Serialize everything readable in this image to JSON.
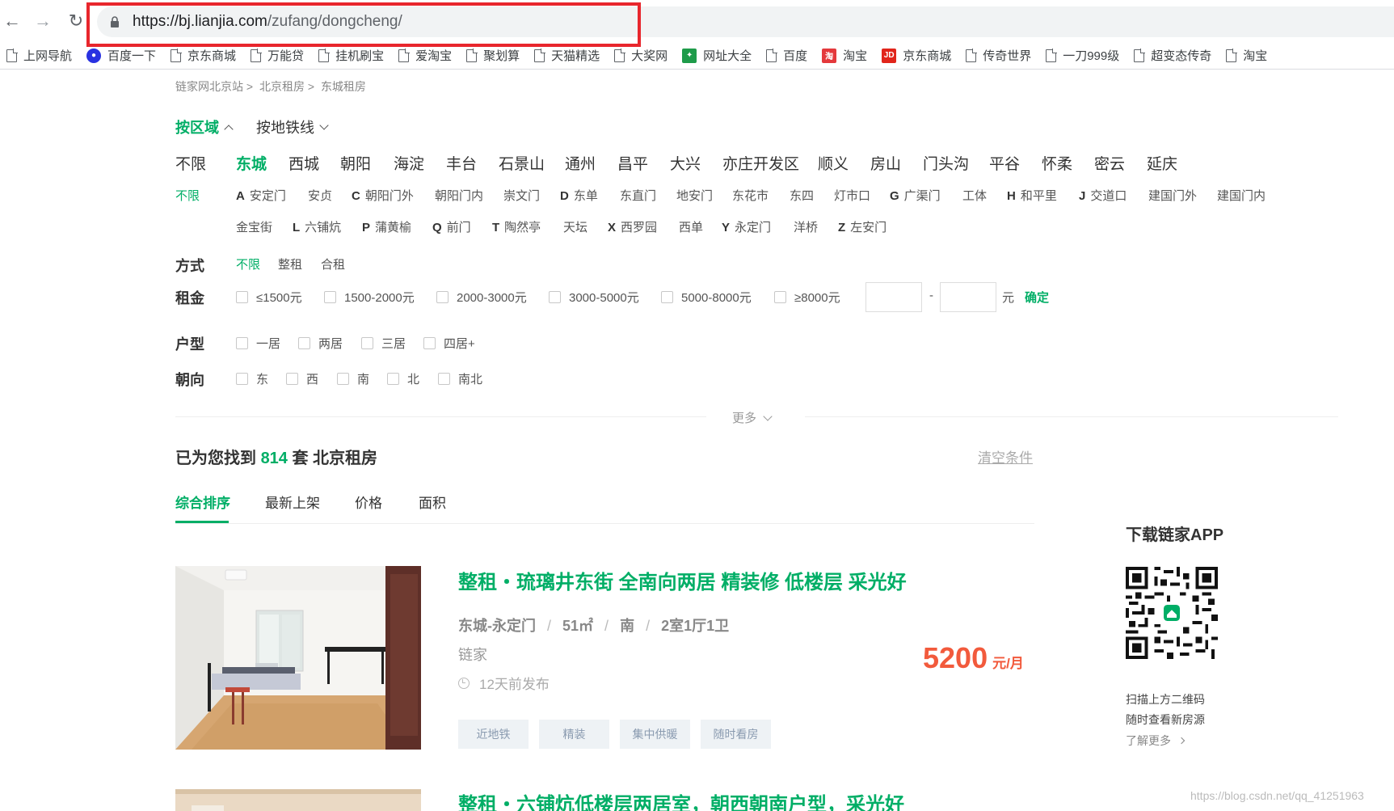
{
  "browser": {
    "url_host": "https://bj.lianjia.com",
    "url_path": "/zufang/dongcheng/",
    "bookmarks": [
      "上网导航",
      "百度一下",
      "京东商城",
      "万能贷",
      "挂机刷宝",
      "爱淘宝",
      "聚划算",
      "天猫精选",
      "大奖网",
      "网址大全",
      "百度",
      "淘宝",
      "京东商城",
      "传奇世界",
      "一刀999级",
      "超变态传奇",
      "淘宝"
    ],
    "fav_labels": {
      "taobao": "淘",
      "jd": "JD"
    }
  },
  "breadcrumb": [
    "链家网北京站 >",
    "北京租房 >",
    "东城租房"
  ],
  "region_tabs": [
    "按区域",
    "按地铁线"
  ],
  "districts": [
    "不限",
    "东城",
    "西城",
    "朝阳",
    "海淀",
    "丰台",
    "石景山",
    "通州",
    "昌平",
    "大兴",
    "亦庄开发区",
    "顺义",
    "房山",
    "门头沟",
    "平谷",
    "怀柔",
    "密云",
    "延庆"
  ],
  "subdistricts": {
    "all": "不限",
    "row1": [
      {
        "letter": "A",
        "name": "安定门"
      },
      {
        "letter": "",
        "name": "安贞"
      },
      {
        "letter": "C",
        "name": "朝阳门外"
      },
      {
        "letter": "",
        "name": "朝阳门内"
      },
      {
        "letter": "",
        "name": "崇文门"
      },
      {
        "letter": "D",
        "name": "东单"
      },
      {
        "letter": "",
        "name": "东直门"
      },
      {
        "letter": "",
        "name": "地安门"
      },
      {
        "letter": "",
        "name": "东花市"
      },
      {
        "letter": "",
        "name": "东四"
      },
      {
        "letter": "",
        "name": "灯市口"
      },
      {
        "letter": "G",
        "name": "广渠门"
      },
      {
        "letter": "",
        "name": "工体"
      },
      {
        "letter": "H",
        "name": "和平里"
      },
      {
        "letter": "J",
        "name": "交道口"
      },
      {
        "letter": "",
        "name": "建国门外"
      },
      {
        "letter": "",
        "name": "建国门内"
      }
    ],
    "row2": [
      {
        "letter": "",
        "name": "金宝街"
      },
      {
        "letter": "L",
        "name": "六铺炕"
      },
      {
        "letter": "P",
        "name": "蒲黄榆"
      },
      {
        "letter": "Q",
        "name": "前门"
      },
      {
        "letter": "T",
        "name": "陶然亭"
      },
      {
        "letter": "",
        "name": "天坛"
      },
      {
        "letter": "X",
        "name": "西罗园"
      },
      {
        "letter": "",
        "name": "西单"
      },
      {
        "letter": "Y",
        "name": "永定门"
      },
      {
        "letter": "",
        "name": "洋桥"
      },
      {
        "letter": "Z",
        "name": "左安门"
      }
    ]
  },
  "filters": {
    "mode_label": "方式",
    "modes": [
      "不限",
      "整租",
      "合租"
    ],
    "rent_label": "租金",
    "rent_options": [
      "≤1500元",
      "1500-2000元",
      "2000-3000元",
      "3000-5000元",
      "5000-8000元",
      "≥8000元"
    ],
    "rent_dash": "-",
    "rent_unit": "元",
    "rent_confirm": "确定",
    "layout_label": "户型",
    "layout_options": [
      "一居",
      "两居",
      "三居",
      "四居+"
    ],
    "orient_label": "朝向",
    "orient_options": [
      "东",
      "西",
      "南",
      "北",
      "南北"
    ],
    "more": "更多"
  },
  "result": {
    "prefix": "已为您找到",
    "count": "814",
    "suffix": "套 北京租房",
    "clear": "清空条件"
  },
  "sort_tabs": [
    "综合排序",
    "最新上架",
    "价格",
    "面积"
  ],
  "listings": [
    {
      "title": "整租・琉璃井东街 全南向两居 精装修 低楼层 采光好",
      "location": "东城-永定门",
      "area": "51㎡",
      "orientation": "南",
      "rooms": "2室1厅1卫",
      "brand": "链家",
      "time": "12天前发布",
      "tags": [
        "近地铁",
        "精装",
        "集中供暖",
        "随时看房"
      ],
      "price": "5200",
      "price_unit": "元/月"
    },
    {
      "title": "整租・六铺炕低楼层两居室，朝西朝南户型，采光好"
    }
  ],
  "sidebar": {
    "title": "下载链家APP",
    "line1": "扫描上方二维码",
    "line2": "随时查看新房源",
    "learn_more": "了解更多"
  },
  "watermark": "https://blog.csdn.net/qq_41251963",
  "colors": {
    "accent": "#00ae66",
    "price": "#f25a3c",
    "highlight": "#e8262d"
  }
}
